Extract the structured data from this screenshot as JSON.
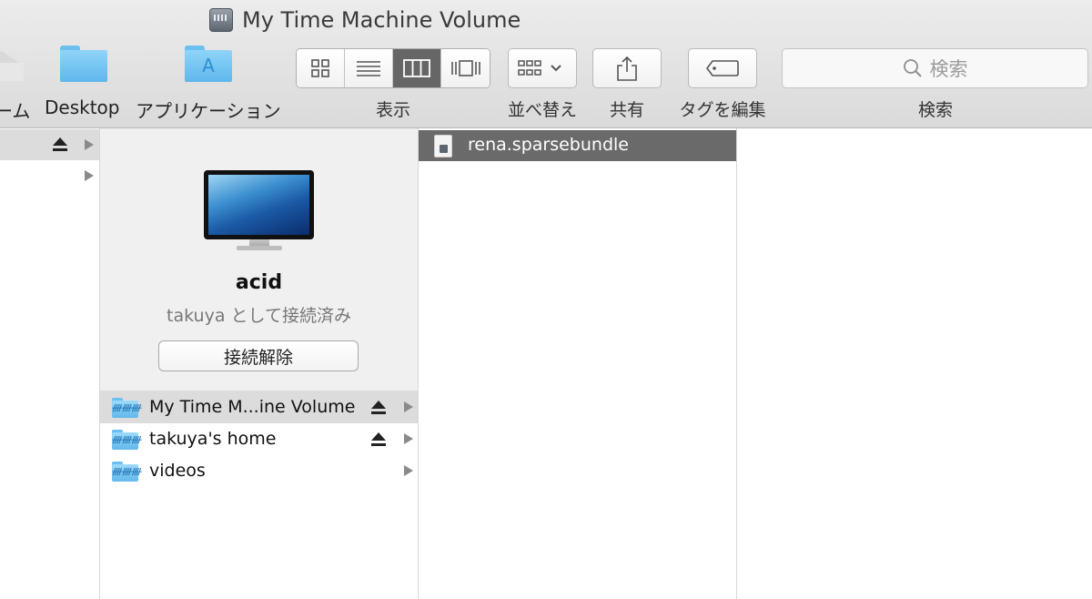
{
  "window": {
    "title": "My Time Machine Volume",
    "title_icon": "network-drive-icon"
  },
  "toolbar": {
    "favorites": [
      {
        "label": "ーム",
        "icon": "home-icon"
      },
      {
        "label": "Desktop",
        "icon": "folder-icon"
      },
      {
        "label": "アプリケーション",
        "icon": "applications-folder-icon"
      }
    ],
    "view_label": "表示",
    "view_modes": [
      {
        "name": "icon-view",
        "icon": "grid-icon",
        "active": false
      },
      {
        "name": "list-view",
        "icon": "list-icon",
        "active": false
      },
      {
        "name": "column-view",
        "icon": "columns-icon",
        "active": true
      },
      {
        "name": "gallery-view",
        "icon": "coverflow-icon",
        "active": false
      }
    ],
    "arrange_label": "並べ替え",
    "share_label": "共有",
    "tags_label": "タグを編集",
    "search_label": "検索",
    "search_placeholder": "検索"
  },
  "server": {
    "name": "acid",
    "status": "takuya として接続済み",
    "disconnect_label": "接続解除"
  },
  "volumes": [
    {
      "name": "My Time M...ine Volume",
      "selected": true,
      "ejectable": true
    },
    {
      "name": "takuya's home",
      "selected": false,
      "ejectable": true
    },
    {
      "name": "videos",
      "selected": false,
      "ejectable": false
    }
  ],
  "files": [
    {
      "name": "rena.sparsebundle",
      "selected": true
    }
  ],
  "colors": {
    "selection_active": "#6a6a6a",
    "selection_inactive": "#dcdcdc",
    "folder_blue": "#62b8ea"
  }
}
